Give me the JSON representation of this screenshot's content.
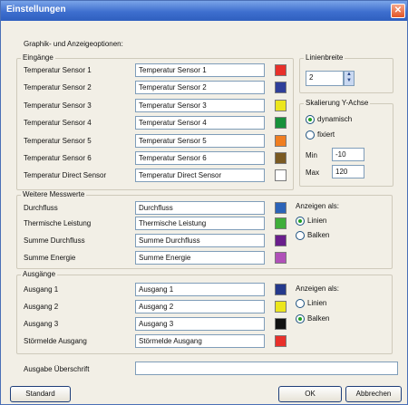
{
  "window": {
    "title": "Einstellungen",
    "close_glyph": "✕"
  },
  "options_heading": "Graphik- und Anzeigeoptionen:",
  "inputs": {
    "title": "Eingänge",
    "rows": [
      {
        "label": "Temperatur Sensor 1",
        "value": "Temperatur Sensor 1",
        "color": "#e8302a"
      },
      {
        "label": "Temperatur Sensor 2",
        "value": "Temperatur Sensor 2",
        "color": "#2f3f99"
      },
      {
        "label": "Temperatur Sensor 3",
        "value": "Temperatur Sensor 3",
        "color": "#ece61c"
      },
      {
        "label": "Temperatur Sensor 4",
        "value": "Temperatur Sensor 4",
        "color": "#17913a"
      },
      {
        "label": "Temperatur Sensor 5",
        "value": "Temperatur Sensor 5",
        "color": "#f07e20"
      },
      {
        "label": "Temperatur Sensor 6",
        "value": "Temperatur Sensor 6",
        "color": "#7a5a22"
      },
      {
        "label": "Temperatur Direct Sensor",
        "value": "Temperatur Direct Sensor",
        "color": "#ffffff"
      }
    ]
  },
  "line_width": {
    "title": "Linienbreite",
    "value": "2",
    "up": "▲",
    "down": "▼"
  },
  "y_scale": {
    "title": "Skalierung Y-Achse",
    "option_dynamic": "dynamisch",
    "option_fixed": "fixiert",
    "min_label": "Min",
    "min_value": "-10",
    "max_label": "Max",
    "max_value": "120"
  },
  "measurements": {
    "title": "Weitere Messwerte",
    "rows": [
      {
        "label": "Durchfluss",
        "value": "Durchfluss",
        "color": "#2b63b8"
      },
      {
        "label": "Thermische Leistung",
        "value": "Thermische Leistung",
        "color": "#3fae3a"
      },
      {
        "label": "Summe Durchfluss",
        "value": "Summe Durchfluss",
        "color": "#6a1e8c"
      },
      {
        "label": "Summe Energie",
        "value": "Summe Energie",
        "color": "#b050b8"
      }
    ],
    "display_label": "Anzeigen als:",
    "option_lines": "Linien",
    "option_bars": "Balken"
  },
  "outputs": {
    "title": "Ausgänge",
    "rows": [
      {
        "label": "Ausgang 1",
        "value": "Ausgang 1",
        "color": "#25398c"
      },
      {
        "label": "Ausgang 2",
        "value": "Ausgang 2",
        "color": "#ece61c"
      },
      {
        "label": "Ausgang 3",
        "value": "Ausgang 3",
        "color": "#111111"
      },
      {
        "label": "Störmelde Ausgang",
        "value": "Störmelde Ausgang",
        "color": "#e8302a"
      }
    ],
    "display_label": "Anzeigen als:",
    "option_lines": "Linien",
    "option_bars": "Balken"
  },
  "heading_output": {
    "label": "Ausgabe Überschrift",
    "value": ""
  },
  "buttons": {
    "standard": "Standard",
    "ok": "OK",
    "cancel": "Abbrechen"
  }
}
